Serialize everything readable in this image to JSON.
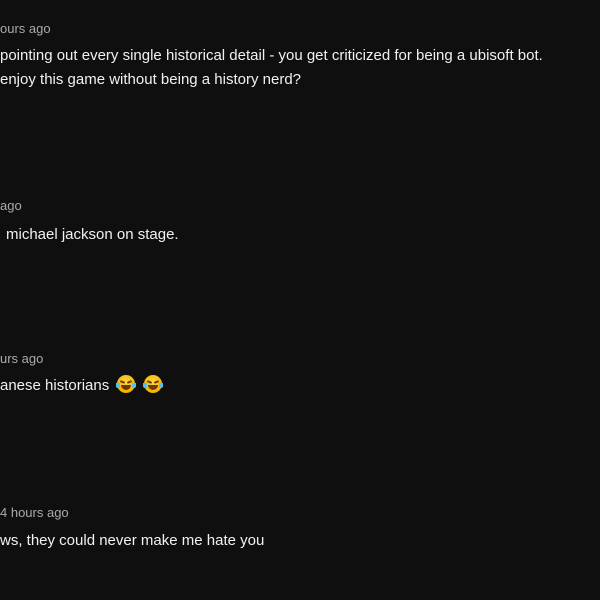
{
  "comments": [
    {
      "time": "ours ago",
      "lines": [
        "pointing out every single historical detail - you get criticized for being a ubisoft bot.",
        "enjoy this game without being a history nerd?"
      ]
    },
    {
      "time": "ago",
      "lines": [
        "michael jackson on stage."
      ]
    },
    {
      "time": "urs ago",
      "lines": [
        "anese historians"
      ],
      "emojis": [
        "face-with-tears-of-joy",
        "face-with-tears-of-joy"
      ]
    },
    {
      "time": "4 hours ago",
      "lines": [
        "ws, they could never make me hate you"
      ]
    }
  ]
}
